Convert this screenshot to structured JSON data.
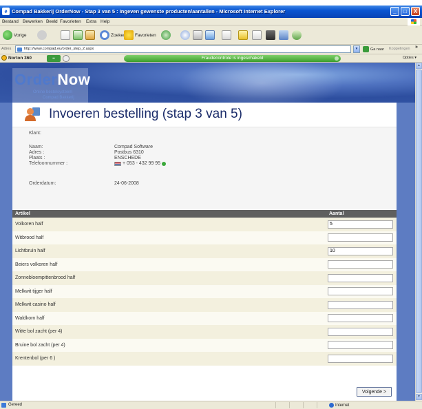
{
  "window": {
    "title": "Compad Bakkerij OrderNow - Stap 3 van 5 : Ingeven gewenste producten/aantallen - Microsoft Internet Explorer",
    "min_label": "_",
    "max_label": "□",
    "close_label": "X"
  },
  "menu": [
    "Bestand",
    "Bewerken",
    "Beeld",
    "Favorieten",
    "Extra",
    "Help"
  ],
  "toolbar": {
    "back_label": "Vorige",
    "search_label": "Zoeken",
    "favorites_label": "Favorieten"
  },
  "address": {
    "label": "Adres",
    "url": "http://www.compad.eu/order_step_2.aspx",
    "go_label": "Ga naar",
    "links_label": "Koppelingen",
    "more_label": "»"
  },
  "norton": {
    "name": "Norton 360",
    "status": "Fraudecontrole is ingeschakeld",
    "options_label": "Opties"
  },
  "brand": {
    "order": "Order",
    "now": "Now",
    "subtitle1": "Online bestelsysteem",
    "subtitle2": "Compad Bakkerij"
  },
  "page": {
    "heading": "Invoeren bestelling (stap 3 van 5)"
  },
  "customer": {
    "klant_label": "Klant:",
    "naam_label": "Naam:",
    "naam_value": "Compad Software",
    "adres_label": "Adres :",
    "adres_value": "Postbus 6310",
    "plaats_label": "Plaats :",
    "plaats_value": "ENSCHEDE",
    "telefoon_label": "Telefoonnummer :",
    "telefoon_value": "+ 053 - 432 99 95",
    "orderdatum_label": "Orderdatum:",
    "orderdatum_value": "24-06-2008"
  },
  "table": {
    "col_artikel": "Artikel",
    "col_aantal": "Aantal",
    "rows": [
      {
        "artikel": "Volkoren half",
        "aantal": "5"
      },
      {
        "artikel": "Witbrood half",
        "aantal": ""
      },
      {
        "artikel": "Lichtbruin half",
        "aantal": "10"
      },
      {
        "artikel": "Beiers volkoren half",
        "aantal": ""
      },
      {
        "artikel": "Zonnebloempittenbrood half",
        "aantal": ""
      },
      {
        "artikel": "Melkwit tijger half",
        "aantal": ""
      },
      {
        "artikel": "Melkwit casino half",
        "aantal": ""
      },
      {
        "artikel": "Waldkorn half",
        "aantal": ""
      },
      {
        "artikel": "Witte bol zacht (per 4)",
        "aantal": ""
      },
      {
        "artikel": "Bruine bol zacht (per 4)",
        "aantal": ""
      },
      {
        "artikel": "Krentenbol (per 6 )",
        "aantal": ""
      }
    ]
  },
  "next_button_label": "Volgende >",
  "statusbar": {
    "status": "Gereed",
    "zone": "Internet"
  }
}
